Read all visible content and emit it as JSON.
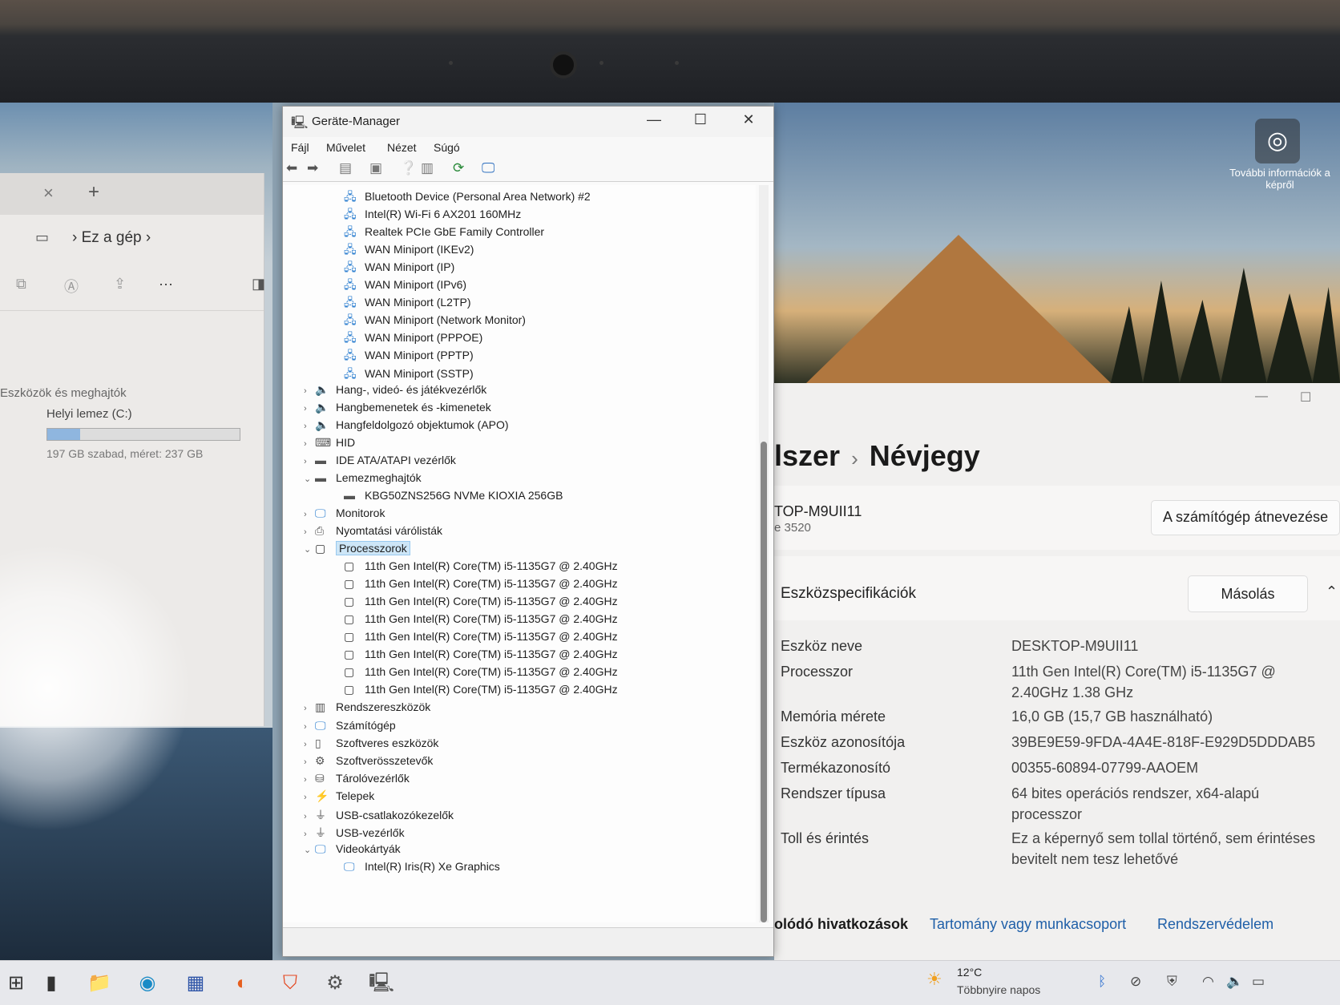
{
  "explorer": {
    "tab_close": "×",
    "tab_new": "+",
    "breadcrumb": "Ez a gép",
    "more": "···",
    "section": "Eszközök és meghajtók",
    "drive_name": "Helyi lemez (C:)",
    "drive_free": "197 GB szabad, méret: 237 GB",
    "drive_used_fraction": 0.17
  },
  "devmgr": {
    "title": "Geräte-Manager",
    "menu": [
      "Fájl",
      "Művelet",
      "Nézet",
      "Súgó"
    ],
    "tree": [
      {
        "label": "Bluetooth Device (Personal Area Network) #2",
        "icon": "net-adapter-icon",
        "level": 2
      },
      {
        "label": "Intel(R) Wi-Fi 6 AX201 160MHz",
        "icon": "net-adapter-icon",
        "level": 2
      },
      {
        "label": "Realtek PCIe GbE Family Controller",
        "icon": "net-adapter-icon",
        "level": 2
      },
      {
        "label": "WAN Miniport (IKEv2)",
        "icon": "net-adapter-icon",
        "level": 2
      },
      {
        "label": "WAN Miniport (IP)",
        "icon": "net-adapter-icon",
        "level": 2
      },
      {
        "label": "WAN Miniport (IPv6)",
        "icon": "net-adapter-icon",
        "level": 2
      },
      {
        "label": "WAN Miniport (L2TP)",
        "icon": "net-adapter-icon",
        "level": 2
      },
      {
        "label": "WAN Miniport (Network Monitor)",
        "icon": "net-adapter-icon",
        "level": 2
      },
      {
        "label": "WAN Miniport (PPPOE)",
        "icon": "net-adapter-icon",
        "level": 2
      },
      {
        "label": "WAN Miniport (PPTP)",
        "icon": "net-adapter-icon",
        "level": 2
      },
      {
        "label": "WAN Miniport (SSTP)",
        "icon": "net-adapter-icon",
        "level": 2
      },
      {
        "label": "Hang-, videó- és játékvezérlők",
        "icon": "speaker-icon",
        "level": 1,
        "exp": "›"
      },
      {
        "label": "Hangbemenetek és -kimenetek",
        "icon": "speaker-icon",
        "level": 1,
        "exp": "›"
      },
      {
        "label": "Hangfeldolgozó objektumok (APO)",
        "icon": "speaker-icon",
        "level": 1,
        "exp": "›"
      },
      {
        "label": "HID",
        "icon": "hid-icon",
        "level": 1,
        "exp": "›"
      },
      {
        "label": "IDE ATA/ATAPI vezérlők",
        "icon": "ide-icon",
        "level": 1,
        "exp": "›"
      },
      {
        "label": "Lemezmeghajtók",
        "icon": "disk-icon",
        "level": 1,
        "exp": "⌄"
      },
      {
        "label": "KBG50ZNS256G NVMe KIOXIA 256GB",
        "icon": "disk-icon",
        "level": 2
      },
      {
        "label": "Monitorok",
        "icon": "monitor-icon",
        "level": 1,
        "exp": "›"
      },
      {
        "label": "Nyomtatási várólisták",
        "icon": "printer-icon",
        "level": 1,
        "exp": "›"
      },
      {
        "label": "Processzorok",
        "icon": "cpu-icon",
        "level": 1,
        "exp": "⌄",
        "selected": true
      },
      {
        "label": "11th Gen Intel(R) Core(TM) i5-1135G7 @ 2.40GHz",
        "icon": "cpu-icon",
        "level": 2
      },
      {
        "label": "11th Gen Intel(R) Core(TM) i5-1135G7 @ 2.40GHz",
        "icon": "cpu-icon",
        "level": 2
      },
      {
        "label": "11th Gen Intel(R) Core(TM) i5-1135G7 @ 2.40GHz",
        "icon": "cpu-icon",
        "level": 2
      },
      {
        "label": "11th Gen Intel(R) Core(TM) i5-1135G7 @ 2.40GHz",
        "icon": "cpu-icon",
        "level": 2
      },
      {
        "label": "11th Gen Intel(R) Core(TM) i5-1135G7 @ 2.40GHz",
        "icon": "cpu-icon",
        "level": 2
      },
      {
        "label": "11th Gen Intel(R) Core(TM) i5-1135G7 @ 2.40GHz",
        "icon": "cpu-icon",
        "level": 2
      },
      {
        "label": "11th Gen Intel(R) Core(TM) i5-1135G7 @ 2.40GHz",
        "icon": "cpu-icon",
        "level": 2
      },
      {
        "label": "11th Gen Intel(R) Core(TM) i5-1135G7 @ 2.40GHz",
        "icon": "cpu-icon",
        "level": 2
      },
      {
        "label": "Rendszereszközök",
        "icon": "system-icon",
        "level": 1,
        "exp": "›"
      },
      {
        "label": "Számítógép",
        "icon": "monitor-icon",
        "level": 1,
        "exp": "›"
      },
      {
        "label": "Szoftveres eszközök",
        "icon": "software-icon",
        "level": 1,
        "exp": "›"
      },
      {
        "label": "Szoftverösszetevők",
        "icon": "component-icon",
        "level": 1,
        "exp": "›"
      },
      {
        "label": "Tárolóvezérlők",
        "icon": "storage-icon",
        "level": 1,
        "exp": "›"
      },
      {
        "label": "Telepek",
        "icon": "battery-icon",
        "level": 1,
        "exp": "›"
      },
      {
        "label": "USB-csatlakozókezelők",
        "icon": "usb-icon",
        "level": 1,
        "exp": "›"
      },
      {
        "label": "USB-vezérlők",
        "icon": "usb-icon",
        "level": 1,
        "exp": "›"
      },
      {
        "label": "Videokártyák",
        "icon": "display-adapter-icon",
        "level": 1,
        "exp": "⌄"
      },
      {
        "label": "Intel(R) Iris(R) Xe Graphics",
        "icon": "display-adapter-icon",
        "level": 2
      }
    ]
  },
  "wallpaper": {
    "info_text": "További információk a képről"
  },
  "settings": {
    "breadcrumb_parent": "lszer",
    "title": "Névjegy",
    "device_name_short": "TOP-M9UII11",
    "device_model": "e 3520",
    "rename_button": "A számítógép átnevezése",
    "spec_title": "Eszközspecifikációk",
    "copy_button": "Másolás",
    "specs": [
      {
        "label": "Eszköz neve",
        "value": "DESKTOP-M9UII11"
      },
      {
        "label": "Processzor",
        "value": "11th Gen Intel(R) Core(TM) i5-1135G7 @ 2.40GHz   1.38 GHz"
      },
      {
        "label": "Memória mérete",
        "value": "16,0 GB (15,7 GB használható)"
      },
      {
        "label": "Eszköz azonosítója",
        "value": "39BE9E59-9FDA-4A4E-818F-E929D5DDDAB5"
      },
      {
        "label": "Termékazonosító",
        "value": "00355-60894-07799-AAOEM"
      },
      {
        "label": "Rendszer típusa",
        "value": "64 bites operációs rendszer, x64-alapú processzor"
      },
      {
        "label": "Toll és érintés",
        "value": "Ez a képernyő sem tollal történő, sem érintéses bevitelt nem tesz lehetővé"
      }
    ],
    "related_label": "olódó hivatkozások",
    "link_domain": "Tartomány vagy munkacsoport",
    "link_protection": "Rendszervédelem",
    "link_color": "#1f5fa8"
  },
  "taskbar": {
    "temp": "12°C",
    "weather": "Többnyire napos"
  }
}
